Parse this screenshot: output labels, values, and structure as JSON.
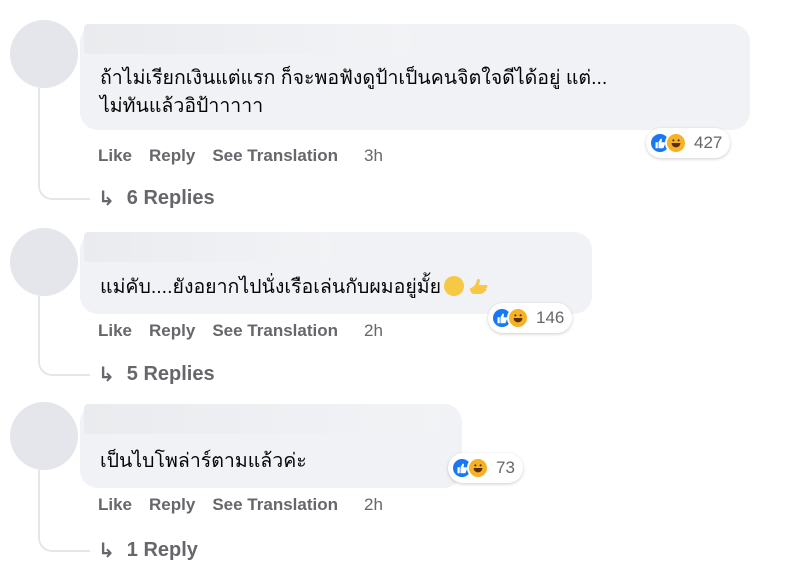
{
  "comments": [
    {
      "text_line1": "ถ้าไม่เรียกเงินแต่แรก ก็จะพอฟังดูป้าเป็นคนจิตใจดีได้อยู่ แต่...",
      "text_line2": "ไม่ทันแล้วอิป้าาาาา",
      "reaction_count": "427",
      "like_label": "Like",
      "reply_label": "Reply",
      "translate_label": "See Translation",
      "time": "3h",
      "replies_label": "6 Replies"
    },
    {
      "text_line1": "แม่คับ....ยังอยากไปนั่งเรือเล่นกับผมอยู่มั้ย",
      "emoji_icons": [
        "smirk-face-icon",
        "pointing-hand-icon"
      ],
      "reaction_count": "146",
      "like_label": "Like",
      "reply_label": "Reply",
      "translate_label": "See Translation",
      "time": "2h",
      "replies_label": "5 Replies"
    },
    {
      "text_line1": "เป็นไบโพล่าร์ตามแล้วค่ะ",
      "reaction_count": "73",
      "like_label": "Like",
      "reply_label": "Reply",
      "translate_label": "See Translation",
      "time": "2h",
      "replies_label": "1 Reply"
    }
  ],
  "colors": {
    "bubble": "#f0f2f5",
    "muted_text": "#65676b",
    "like_blue": "#1877f2",
    "haha_yellow": "#f7b125"
  }
}
